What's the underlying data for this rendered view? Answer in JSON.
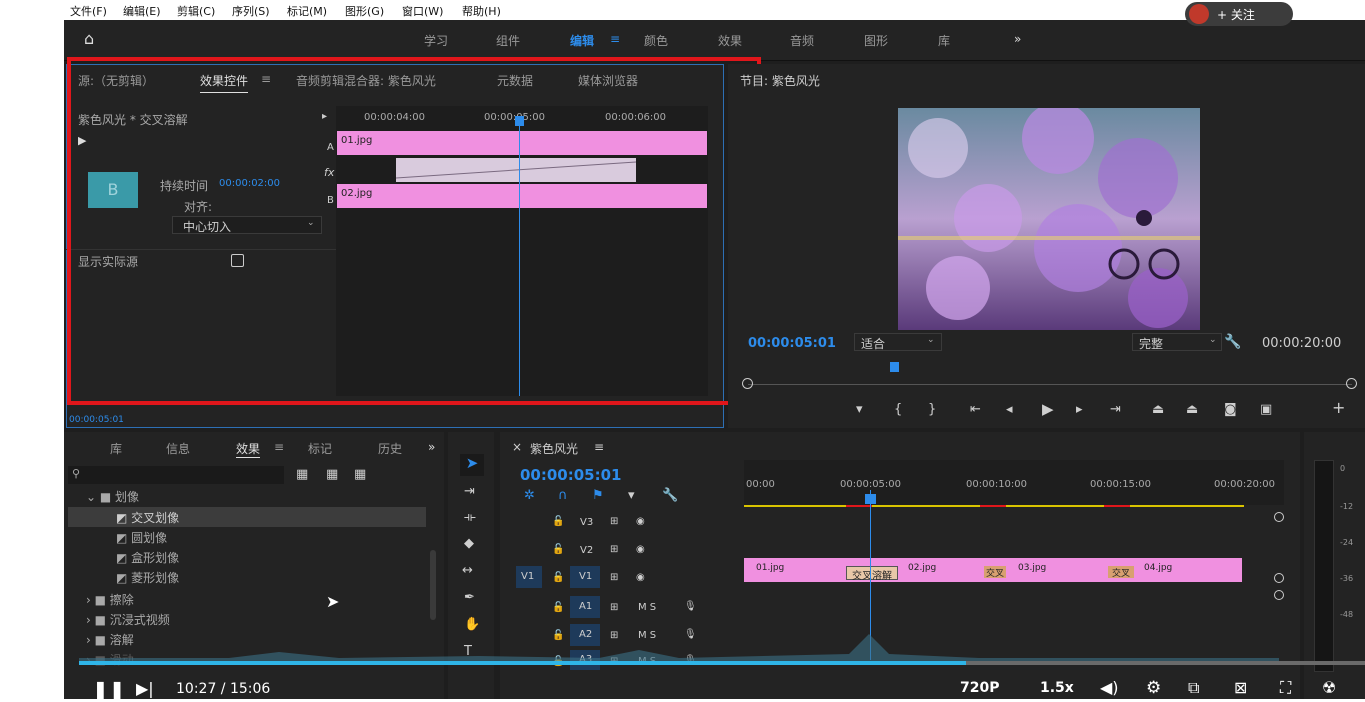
{
  "menubar": {
    "items": [
      "文件(F)",
      "编辑(E)",
      "剪辑(C)",
      "序列(S)",
      "标记(M)",
      "图形(G)",
      "窗口(W)",
      "帮助(H)"
    ],
    "follow_label": "+ 关注"
  },
  "workspaces": {
    "items": [
      "学习",
      "组件",
      "编辑",
      "颜色",
      "效果",
      "音频",
      "图形",
      "库"
    ],
    "active": "编辑",
    "more": "»"
  },
  "source_panel": {
    "tabs": [
      "源:（无剪辑）",
      "效果控件",
      "音频剪辑混合器: 紫色风光",
      "元数据",
      "媒体浏览器"
    ],
    "active_tab": "效果控件",
    "clip_title": "紫色风光 * 交叉溶解",
    "duration_label": "持续时间",
    "duration_value": "00:00:02:00",
    "align_label": "对齐:",
    "align_value": "中心切入",
    "show_source_label": "显示实际源",
    "timecode": "00:00:05:01",
    "ruler": [
      "00:00:04:00",
      "00:00:05:00",
      "00:00:06:00"
    ],
    "clip_a": "01.jpg",
    "clip_b": "02.jpg",
    "track_a": "A",
    "track_b": "B",
    "fx": "fx",
    "transition_icon": "B"
  },
  "program_panel": {
    "title": "节目: 紫色风光",
    "timecode": "00:00:05:01",
    "fit": "适合",
    "quality": "完整",
    "duration": "00:00:20:00"
  },
  "effects_panel": {
    "tabs": [
      "库",
      "信息",
      "效果",
      "标记",
      "历史"
    ],
    "active_tab": "效果",
    "more": "»",
    "tree": [
      {
        "label": "划像",
        "level": 0,
        "open": true
      },
      {
        "label": "交叉划像",
        "level": 1,
        "selected": true
      },
      {
        "label": "圆划像",
        "level": 1
      },
      {
        "label": "盒形划像",
        "level": 1
      },
      {
        "label": "菱形划像",
        "level": 1
      },
      {
        "label": "擦除",
        "level": 0
      },
      {
        "label": "沉浸式视频",
        "level": 0
      },
      {
        "label": "溶解",
        "level": 0
      },
      {
        "label": "滑动",
        "level": 0
      }
    ]
  },
  "timeline": {
    "title": "紫色风光",
    "timecode": "00:00:05:01",
    "ruler": [
      "00:00",
      "00:00:05:00",
      "00:00:10:00",
      "00:00:15:00",
      "00:00:20:00"
    ],
    "tracks": [
      {
        "label": "V3",
        "letters": ""
      },
      {
        "label": "V2",
        "letters": ""
      },
      {
        "label": "V1",
        "letters": "",
        "source": "V1"
      },
      {
        "label": "A1",
        "letters": "M S"
      },
      {
        "label": "A2",
        "letters": "M S"
      },
      {
        "label": "A3",
        "letters": "M S"
      }
    ],
    "clips": [
      "01.jpg",
      "交叉溶解",
      "02.jpg",
      "交叉",
      "03.jpg",
      "交叉",
      "04.jpg"
    ],
    "meter_scale": [
      "0",
      "-12",
      "-24",
      "-36",
      "-48"
    ]
  },
  "player": {
    "time": "10:27 / 15:06",
    "quality": "720P",
    "speed": "1.5x",
    "progress": 0.69
  }
}
